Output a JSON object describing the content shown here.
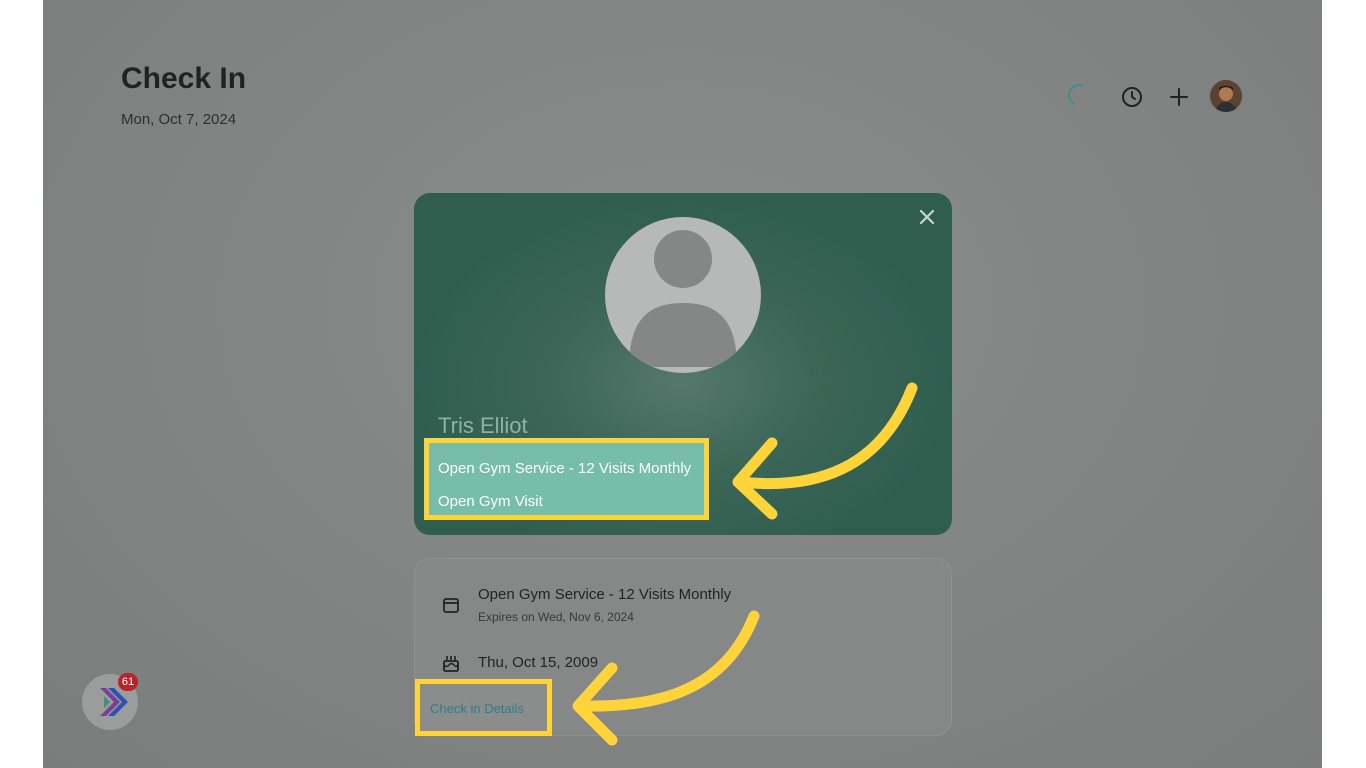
{
  "header": {
    "title": "Check In",
    "date": "Mon, Oct 7, 2024"
  },
  "top_actions": {
    "icons": [
      "loading-spinner",
      "clock-icon",
      "plus-icon",
      "user-avatar"
    ]
  },
  "member": {
    "name": "Tris Elliot",
    "services": [
      "Open Gym Service - 12 Visits Monthly",
      "Open Gym Visit"
    ]
  },
  "details": {
    "membership_title": "Open Gym Service - 12 Visits Monthly",
    "membership_expiry": "Expires on Wed, Nov 6, 2024",
    "birthday": "Thu, Oct 15, 2009",
    "checkin_link": "Check in Details"
  },
  "widget": {
    "badge_count": "61"
  },
  "colors": {
    "card_green": "#2f5e4f",
    "highlight_yellow": "#ffd43b",
    "service_box": "#76bdaa",
    "link_teal": "#2f7e8c",
    "badge_red": "#b8232a"
  }
}
